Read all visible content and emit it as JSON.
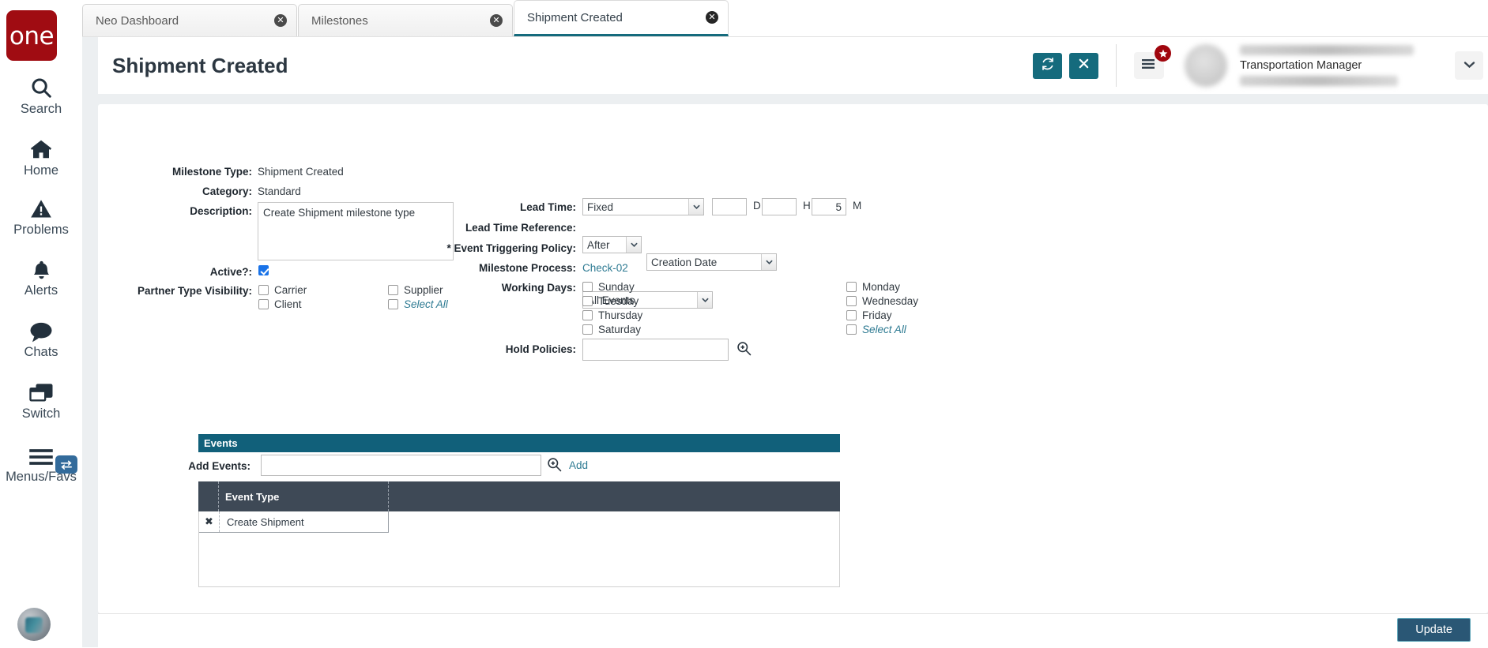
{
  "brand": {
    "logo_text": "one"
  },
  "rail": {
    "items": [
      {
        "label": "Search",
        "icon": "search-icon"
      },
      {
        "label": "Home",
        "icon": "home-icon"
      },
      {
        "label": "Problems",
        "icon": "warning-triangle-icon"
      },
      {
        "label": "Alerts",
        "icon": "bell-icon"
      },
      {
        "label": "Chats",
        "icon": "chat-bubble-icon"
      },
      {
        "label": "Switch",
        "icon": "switch-windows-icon"
      },
      {
        "label": "Menus/Favs",
        "icon": "hamburger-icon"
      }
    ]
  },
  "tabs": [
    {
      "label": "Neo Dashboard",
      "active": false,
      "close": "✕"
    },
    {
      "label": "Milestones",
      "active": false,
      "close": "✕"
    },
    {
      "label": "Shipment Created",
      "active": true,
      "close": "✕"
    }
  ],
  "header": {
    "title": "Shipment Created",
    "refresh_icon": "refresh-icon",
    "close_icon": "close-icon",
    "menu_icon": "list-menu-icon",
    "badge_icon": "star-badge-icon",
    "caret_icon": "chevron-down-icon",
    "user_role": "Transportation Manager"
  },
  "form": {
    "milestone_type": {
      "label": "Milestone Type:",
      "value": "Shipment Created"
    },
    "category": {
      "label": "Category:",
      "value": "Standard"
    },
    "description": {
      "label": "Description:",
      "value": "Create Shipment milestone type",
      "placeholder": ""
    },
    "active": {
      "label": "Active?:",
      "checked": true
    },
    "partner_type_visibility": {
      "label": "Partner Type Visibility:",
      "left": [
        {
          "label": "Carrier",
          "checked": false,
          "italic": false
        },
        {
          "label": "Client",
          "checked": false,
          "italic": false
        }
      ],
      "right": [
        {
          "label": "Supplier",
          "checked": false,
          "italic": false
        },
        {
          "label": "Select All",
          "checked": false,
          "italic": true
        }
      ]
    },
    "lead_time": {
      "label": "Lead Time:",
      "mode": "Fixed",
      "days": "",
      "days_unit": "D",
      "hours": "",
      "hours_unit": "H",
      "minutes": "5",
      "minutes_unit": "M"
    },
    "lead_time_reference": {
      "label": "Lead Time Reference:",
      "direction": "After",
      "anchor": "Creation Date"
    },
    "event_triggering_policy": {
      "label": "* Event Triggering Policy:",
      "value": "All Events"
    },
    "milestone_process": {
      "label": "Milestone Process:",
      "value": "Check-02"
    },
    "working_days": {
      "label": "Working Days:",
      "left": [
        {
          "label": "Sunday",
          "checked": false,
          "italic": false
        },
        {
          "label": "Tuesday",
          "checked": false,
          "italic": false
        },
        {
          "label": "Thursday",
          "checked": false,
          "italic": false
        },
        {
          "label": "Saturday",
          "checked": false,
          "italic": false
        }
      ],
      "right": [
        {
          "label": "Monday",
          "checked": false,
          "italic": false
        },
        {
          "label": "Wednesday",
          "checked": false,
          "italic": false
        },
        {
          "label": "Friday",
          "checked": false,
          "italic": false
        },
        {
          "label": "Select All",
          "checked": false,
          "italic": true
        }
      ]
    },
    "hold_policies": {
      "label": "Hold Policies:",
      "value": "",
      "search_icon": "magnifier-icon"
    }
  },
  "events": {
    "section_title": "Events",
    "add_events": {
      "label": "Add Events:",
      "value": "",
      "search_icon": "magnifier-icon",
      "add_label": "Add"
    },
    "columns": [
      "Event Type"
    ],
    "rows": [
      {
        "remove": "✖",
        "event_type": "Create Shipment"
      }
    ]
  },
  "footer": {
    "update_label": "Update"
  },
  "colors": {
    "brand_red": "#A00C12",
    "teal": "#156B7D",
    "section_teal": "#11607A",
    "table_header": "#3E4956",
    "update_blue": "#2A5775",
    "link": "#2D7A92",
    "checkbox_blue": "#1A73E8"
  }
}
